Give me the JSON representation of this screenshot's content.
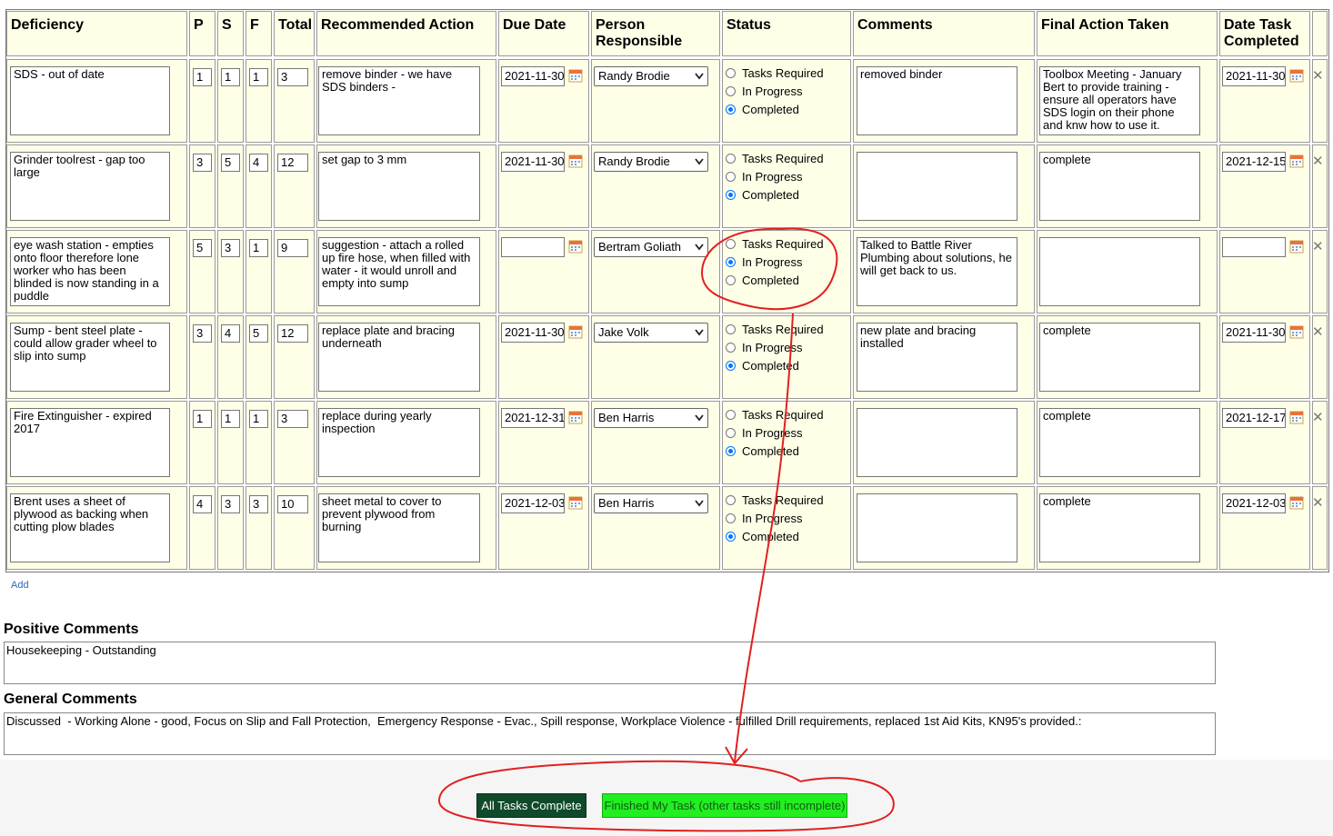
{
  "columns": {
    "deficiency": "Deficiency",
    "p": "P",
    "s": "S",
    "f": "F",
    "total": "Total",
    "recommended_action": "Recommended Action",
    "due_date": "Due Date",
    "person_responsible": "Person\nResponsible",
    "status": "Status",
    "comments": "Comments",
    "final_action": "Final Action Taken",
    "date_completed": "Date Task\nCompleted"
  },
  "status_options": [
    "Tasks Required",
    "In Progress",
    "Completed"
  ],
  "rows": [
    {
      "deficiency": "SDS - out of date",
      "p": "1",
      "s": "1",
      "f": "1",
      "total": "3",
      "action": "remove binder - we have SDS binders -",
      "due": "2021-11-30",
      "person": "Randy Brodie",
      "status": "Completed",
      "comments": "removed binder",
      "final": "Toolbox Meeting - January\nBert to provide training - ensure all operators have SDS login on their phone and knw how to use it.",
      "completed": "2021-11-30"
    },
    {
      "deficiency": "Grinder toolrest - gap too large",
      "p": "3",
      "s": "5",
      "f": "4",
      "total": "12",
      "action": "set gap to 3 mm",
      "due": "2021-11-30",
      "person": "Randy Brodie",
      "status": "Completed",
      "comments": "",
      "final": "complete",
      "completed": "2021-12-15"
    },
    {
      "deficiency": "eye wash station - empties onto floor therefore lone worker who has been blinded is now standing in a puddle",
      "p": "5",
      "s": "3",
      "f": "1",
      "total": "9",
      "action": "suggestion - attach a rolled up fire hose, when filled with water - it would unroll and empty into sump",
      "due": "",
      "person": "Bertram Goliath",
      "status": "In Progress",
      "comments": "Talked to Battle River Plumbing about solutions, he will get back to us.",
      "final": "",
      "completed": ""
    },
    {
      "deficiency": "Sump - bent steel plate - could allow grader wheel to slip into sump",
      "p": "3",
      "s": "4",
      "f": "5",
      "total": "12",
      "action": "replace plate and bracing underneath",
      "due": "2021-11-30",
      "person": "Jake Volk",
      "status": "Completed",
      "comments": "new plate and bracing installed",
      "final": "complete",
      "completed": "2021-11-30"
    },
    {
      "deficiency": "Fire Extinguisher - expired 2017",
      "p": "1",
      "s": "1",
      "f": "1",
      "total": "3",
      "action": "replace during yearly inspection",
      "due": "2021-12-31",
      "person": "Ben Harris",
      "status": "Completed",
      "comments": "",
      "final": "complete",
      "completed": "2021-12-17"
    },
    {
      "deficiency": "Brent uses a sheet of plywood as backing when cutting plow blades",
      "p": "4",
      "s": "3",
      "f": "3",
      "total": "10",
      "action": "sheet metal to cover to prevent plywood from burning",
      "due": "2021-12-03",
      "person": "Ben Harris",
      "status": "Completed",
      "comments": "",
      "final": "complete",
      "completed": "2021-12-03"
    }
  ],
  "add_label": "Add",
  "positive_comments": {
    "title": "Positive Comments",
    "value": "Housekeeping - Outstanding"
  },
  "general_comments": {
    "title": "General Comments",
    "value": "Discussed  - Working Alone - good, Focus on Slip and Fall Protection,  Emergency Response - Evac., Spill response, Workplace Violence - fulfilled Drill requirements, replaced 1st Aid Kits, KN95's provided.:"
  },
  "buttons": {
    "all_complete": "All Tasks Complete",
    "finished_mine": "Finished My Task (other tasks still incomplete)"
  },
  "colors": {
    "cell_bg": "#ffffe8",
    "btn_dark": "#0f4a2a",
    "btn_green": "#22ee22",
    "annotation": "#e02020",
    "radio_checked": "#0075ff"
  },
  "icons": {
    "calendar": "calendar-icon",
    "delete": "close-icon",
    "select_arrow": "chevron-down-icon"
  }
}
